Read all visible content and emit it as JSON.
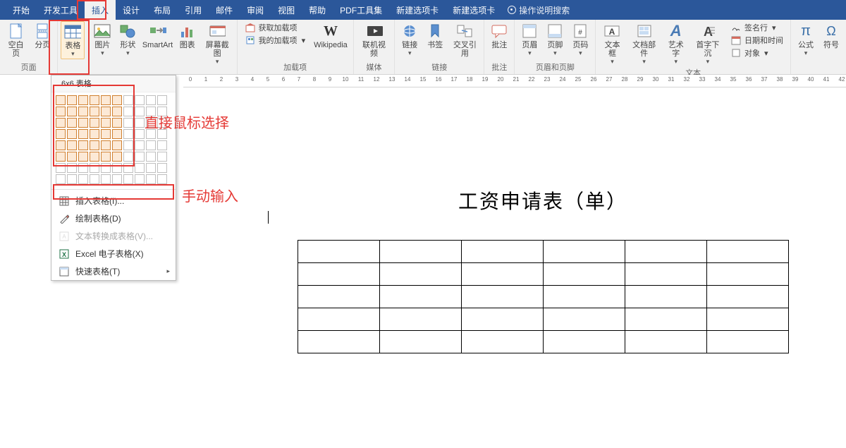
{
  "tabs": {
    "t0": "开始",
    "t1": "开发工具",
    "t2": "插入",
    "t3": "设计",
    "t4": "布局",
    "t5": "引用",
    "t6": "邮件",
    "t7": "审阅",
    "t8": "视图",
    "t9": "帮助",
    "t10": "PDF工具集",
    "t11": "新建选项卡",
    "t12": "新建选项卡",
    "tellme": "操作说明搜索"
  },
  "ribbon": {
    "pages": {
      "blank": "空白页",
      "break": "分页",
      "label": "页面"
    },
    "table": {
      "button": "表格"
    },
    "illus": {
      "pic": "图片",
      "shapes": "形状",
      "smartart": "SmartArt",
      "chart": "图表",
      "screenshot": "屏幕截图"
    },
    "addins": {
      "get": "获取加载项",
      "my": "我的加载项",
      "wiki": "Wikipedia",
      "label": "加载项"
    },
    "media": {
      "video": "联机视频",
      "label": "媒体"
    },
    "links": {
      "link": "链接",
      "bookmark": "书签",
      "crossref": "交叉引用",
      "label": "链接"
    },
    "comments": {
      "comment": "批注",
      "label": "批注"
    },
    "headerfooter": {
      "header": "页眉",
      "footer": "页脚",
      "pageno": "页码",
      "label": "页眉和页脚"
    },
    "text": {
      "textbox": "文本框",
      "parts": "文档部件",
      "wordart": "艺术字",
      "dropcap": "首字下沉",
      "sig": "签名行",
      "datetime": "日期和时间",
      "object": "对象",
      "label": "文本"
    },
    "symbols": {
      "equation": "公式",
      "symbol": "符号"
    }
  },
  "dropdown": {
    "title": "6x6 表格",
    "insert": "插入表格(I)...",
    "draw": "绘制表格(D)",
    "convert": "文本转换成表格(V)...",
    "excel": "Excel 电子表格(X)",
    "quick": "快速表格(T)"
  },
  "document": {
    "title": "工资申请表（单）",
    "table_rows": 5,
    "table_cols": 6
  },
  "annotations": {
    "direct_select": "直接鼠标选择",
    "manual_input": "手动输入"
  }
}
